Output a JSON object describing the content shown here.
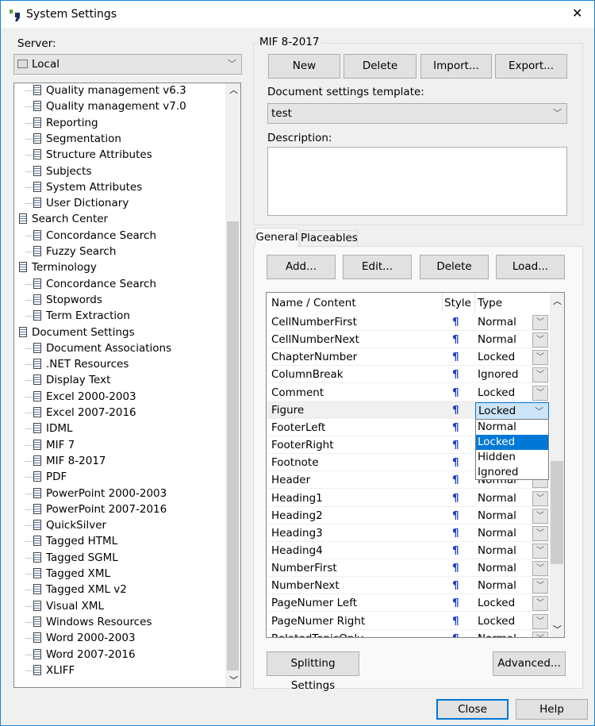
{
  "window": {
    "title": "System Settings",
    "close_glyph": "✕"
  },
  "server": {
    "label": "Server:",
    "value": "Local"
  },
  "tree": [
    {
      "label": "Quality management v6.3",
      "level": 1
    },
    {
      "label": "Quality management v7.0",
      "level": 1
    },
    {
      "label": "Reporting",
      "level": 1
    },
    {
      "label": "Segmentation",
      "level": 1
    },
    {
      "label": "Structure Attributes",
      "level": 1
    },
    {
      "label": "Subjects",
      "level": 1
    },
    {
      "label": "System Attributes",
      "level": 1
    },
    {
      "label": "User Dictionary",
      "level": 1
    },
    {
      "label": "Search Center",
      "level": 0
    },
    {
      "label": "Concordance Search",
      "level": 1
    },
    {
      "label": "Fuzzy Search",
      "level": 1
    },
    {
      "label": "Terminology",
      "level": 0
    },
    {
      "label": "Concordance Search",
      "level": 1
    },
    {
      "label": "Stopwords",
      "level": 1
    },
    {
      "label": "Term Extraction",
      "level": 1
    },
    {
      "label": "Document Settings",
      "level": 0
    },
    {
      "label": "Document Associations",
      "level": 1
    },
    {
      "label": ".NET Resources",
      "level": 1
    },
    {
      "label": "Display Text",
      "level": 1
    },
    {
      "label": "Excel 2000-2003",
      "level": 1
    },
    {
      "label": "Excel 2007-2016",
      "level": 1
    },
    {
      "label": "IDML",
      "level": 1
    },
    {
      "label": "MIF 7",
      "level": 1
    },
    {
      "label": "MIF 8-2017",
      "level": 1,
      "selected": true
    },
    {
      "label": "PDF",
      "level": 1
    },
    {
      "label": "PowerPoint 2000-2003",
      "level": 1
    },
    {
      "label": "PowerPoint 2007-2016",
      "level": 1
    },
    {
      "label": "QuickSilver",
      "level": 1
    },
    {
      "label": "Tagged HTML",
      "level": 1
    },
    {
      "label": "Tagged SGML",
      "level": 1
    },
    {
      "label": "Tagged XML",
      "level": 1
    },
    {
      "label": "Tagged XML v2",
      "level": 1
    },
    {
      "label": "Visual XML",
      "level": 1
    },
    {
      "label": "Windows Resources",
      "level": 1
    },
    {
      "label": "Word 2000-2003",
      "level": 1
    },
    {
      "label": "Word 2007-2016",
      "level": 1
    },
    {
      "label": "XLIFF",
      "level": 1
    }
  ],
  "group": {
    "title": "MIF 8-2017",
    "buttons": [
      "New",
      "Delete",
      "Import...",
      "Export..."
    ],
    "template_label": "Document settings template:",
    "template_value": "test",
    "description_label": "Description:",
    "description_value": ""
  },
  "tabs": [
    "General",
    "Placeables"
  ],
  "general": {
    "buttons": [
      "Add...",
      "Edit...",
      "Delete",
      "Load..."
    ],
    "columns": [
      "Name / Content",
      "Style",
      "Type"
    ],
    "style_glyph": "¶",
    "rows": [
      {
        "name": "CellNumberFirst",
        "type": "Normal"
      },
      {
        "name": "CellNumberNext",
        "type": "Normal"
      },
      {
        "name": "ChapterNumber",
        "type": "Locked"
      },
      {
        "name": "ColumnBreak",
        "type": "Ignored"
      },
      {
        "name": "Comment",
        "type": "Locked"
      },
      {
        "name": "Figure",
        "type": "Locked",
        "editing": true
      },
      {
        "name": "FooterLeft",
        "type": ""
      },
      {
        "name": "FooterRight",
        "type": ""
      },
      {
        "name": "Footnote",
        "type": ""
      },
      {
        "name": "Header",
        "type": "Normal"
      },
      {
        "name": "Heading1",
        "type": "Normal"
      },
      {
        "name": "Heading2",
        "type": "Normal"
      },
      {
        "name": "Heading3",
        "type": "Normal"
      },
      {
        "name": "Heading4",
        "type": "Normal"
      },
      {
        "name": "NumberFirst",
        "type": "Normal"
      },
      {
        "name": "NumberNext",
        "type": "Normal"
      },
      {
        "name": "PageNumer Left",
        "type": "Locked"
      },
      {
        "name": "PageNumer Right",
        "type": "Locked"
      },
      {
        "name": "RelatedTopicOnly",
        "type": "Normal"
      }
    ],
    "dropdown_options": [
      "Normal",
      "Locked",
      "Hidden",
      "Ignored"
    ],
    "dropdown_selected": "Locked",
    "splitting_label": "Splitting Settings",
    "advanced_label": "Advanced..."
  },
  "footer": {
    "close_label": "Close",
    "help_label": "Help"
  },
  "colors": {
    "accent": "#0078d7",
    "logo_green": "#5aa532",
    "logo_navy": "#1e2d5a"
  }
}
